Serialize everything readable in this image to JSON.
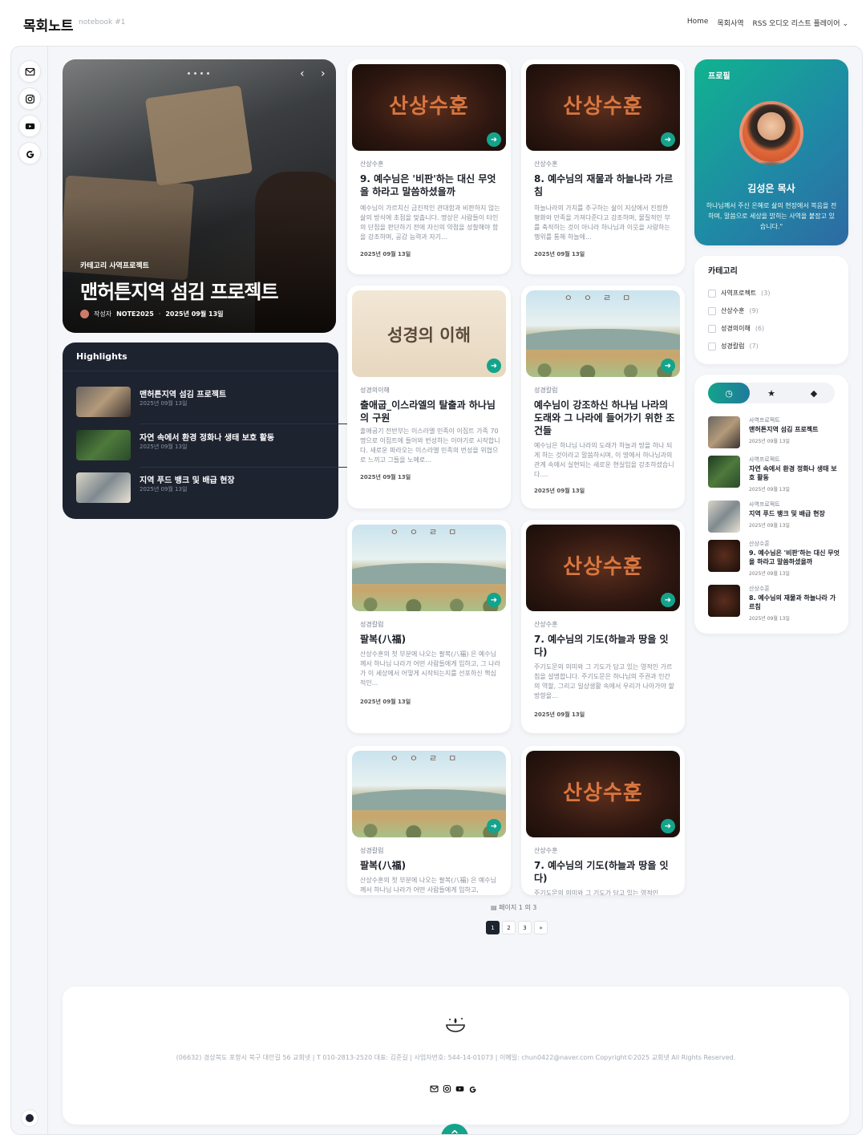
{
  "site": {
    "title": "목회노트",
    "subtitle": "notebook #1"
  },
  "nav": {
    "items": [
      "Home",
      "목회사역",
      "RSS 오디오 리스트 플레이어"
    ],
    "dropdown_icon": "chevron-down-icon"
  },
  "rail": {
    "icons": [
      "mail-icon",
      "instagram-icon",
      "youtube-icon",
      "google-icon"
    ]
  },
  "hero": {
    "category": "카테고리 사역프로젝트",
    "title": "맨허튼지역 섬김 프로젝트",
    "author_label": "작성자",
    "author": "NOTE2025",
    "date": "2025년 09월 13일"
  },
  "highlights": {
    "title": "Highlights",
    "items": [
      {
        "title": "맨허튼지역 섬김 프로젝트",
        "date": "2025년 09월 13일"
      },
      {
        "title": "자연 속에서 환경 정화나 생태 보호 활동",
        "date": "2025년 09월 13일"
      },
      {
        "title": "지역 푸드 뱅크 및 배급 현장",
        "date": "2025년 09월 13일"
      }
    ]
  },
  "posts": [
    {
      "thumb_text": "산상수훈",
      "category": "산상수훈",
      "title": "9. 예수님은 '비판'하는 대신 무엇을 하라고 말씀하셨을까",
      "excerpt": "예수님이 가르치신 금진적인 관대함과 비판하지 않는 삶의 방식에 초점을 맞춥니다. 명상은 사람들이 타인의 단점을 판단하기 전에 자신의 약점을 성찰해야 함을 강조하며, 공감 능력과 자기...",
      "date": "2025년 09월 13일"
    },
    {
      "thumb_text": "산상수훈",
      "category": "산상수훈",
      "title": "8. 예수님의 재물과 하늘나라 가르침",
      "excerpt": "하늘나라의 가치를 추구하는 삶이 지상에서 진정한 평화와 만족을 가져다준다고 강조하며, 물질적인 부를 축적하는 것이 아니라 하나님과 이웃을 사랑하는 행위를 통해 하늘에...",
      "date": "2025년 09월 13일"
    },
    {
      "thumb_text": "성경의 이해",
      "category": "성경의이해",
      "title": "출애굽_이스라엘의 탈출과 하나님의 구원",
      "excerpt": "출애굽기 전반부는 이스라엘 민족이 이집트 가족 70명으로 이집트에 들어와 번성하는 이야기로 시작합니다. 새로운 파라오는 이스라엘 민족의 번성을 위협으로 느끼고 그들을 노예로...",
      "date": "2025년 09월 13일"
    },
    {
      "thumb_text": "ㅇㅇㄹㅁ",
      "category": "성경칼럼",
      "title": "예수님이 강조하신 하나님 나라의 도래와 그 나라에 들어가기 위한 조건들",
      "excerpt": "예수님은 하나님 나라의 도래가 하늘과 땅을 하나 되게 하는 것이라고 말씀하시며, 이 땅에서 하나님과의 관계 속에서 실현되는 새로운 현실임을 강조하셨습니다....",
      "date": "2025년 09월 13일"
    },
    {
      "thumb_text": "ㅇㅇㄹㅁ",
      "category": "성경칼럼",
      "title": "팔복(八福)",
      "excerpt": "산상수훈의 첫 부분에 나오는 팔복(八福) 은 예수님께서 하나님 나라가 어떤 사람들에게 임하고, 그 나라가 이 세상에서 어떻게 시작되는지를 선포하신 핵심적인...",
      "date": "2025년 09월 13일"
    },
    {
      "thumb_text": "산상수훈",
      "category": "산상수훈",
      "title": "7. 예수님의 기도(하늘과 땅을 잇다)",
      "excerpt": "주기도문의 의미와 그 기도가 담고 있는 영적인 가르침을 설명합니다. 주기도문은 하나님의 주권과 인간의 역할, 그리고 일상생활 속에서 우리가 나아가야 할 방향을...",
      "date": "2025년 09월 13일"
    },
    {
      "thumb_text": "ㅇㅇㄹㅁ",
      "category": "성경칼럼",
      "title": "팔복(八福)",
      "excerpt": "산상수훈의 첫 부분에 나오는 팔복(八福) 은 예수님께서 하나님 나라가 어떤 사람들에게 임하고,",
      "date": ""
    },
    {
      "thumb_text": "산상수훈",
      "category": "산상수훈",
      "title": "7. 예수님의 기도(하늘과 땅을 잇다)",
      "excerpt": "주기도문의 의미와 그 기도가 담고 있는 영적인",
      "date": ""
    }
  ],
  "pagination": {
    "info": "페이지 1 의 3",
    "pages": [
      "1",
      "2",
      "3",
      "»"
    ],
    "current": "1"
  },
  "profile": {
    "heading": "프로필",
    "name": "김성은 목사",
    "bio": "하나님께서 주신 은혜로 삶의 현장에서 복음을 전하며, 말씀으로 세상을 밝히는 사역을 붙잡고 있습니다.\""
  },
  "categories": {
    "heading": "카테고리",
    "items": [
      {
        "name": "사역프로젝트",
        "count": "(3)"
      },
      {
        "name": "산상수훈",
        "count": "(9)"
      },
      {
        "name": "성경의이해",
        "count": "(6)"
      },
      {
        "name": "성경칼럼",
        "count": "(7)"
      }
    ]
  },
  "recent": {
    "tab_icons": [
      "clock-icon",
      "star-icon",
      "tag-icon"
    ],
    "items": [
      {
        "category": "사역프로젝트",
        "title": "맨허튼지역 섬김 프로젝트",
        "date": "2025년 09월 13일"
      },
      {
        "category": "사역프로젝트",
        "title": "자연 속에서 환경 정화나 생태 보호 활동",
        "date": "2025년 09월 13일"
      },
      {
        "category": "사역프로젝트",
        "title": "지역 푸드 뱅크 및 배급 현장",
        "date": "2025년 09월 13일"
      },
      {
        "category": "산상수훈",
        "title": "9. 예수님은 '비판'하는 대신 무엇을 하라고 말씀하셨을까",
        "date": "2025년 09월 13일"
      },
      {
        "category": "산상수훈",
        "title": "8. 예수님의 재물과 하늘나라 가르침",
        "date": "2025년 09월 13일"
      }
    ]
  },
  "footer": {
    "text": "(06632) 경상북도 포항시 북구 대안길 56 교회넷 | T 010-2813-2520 대표: 김준길 | 사업자번호: 544-14-01073 | 이메일: chun0422@naver.com Copyright©2025 교회넷 All Rights Reserved."
  },
  "colors": {
    "accent": "#14a38b",
    "dark": "#1e2330",
    "background": "#f4f6f9"
  }
}
